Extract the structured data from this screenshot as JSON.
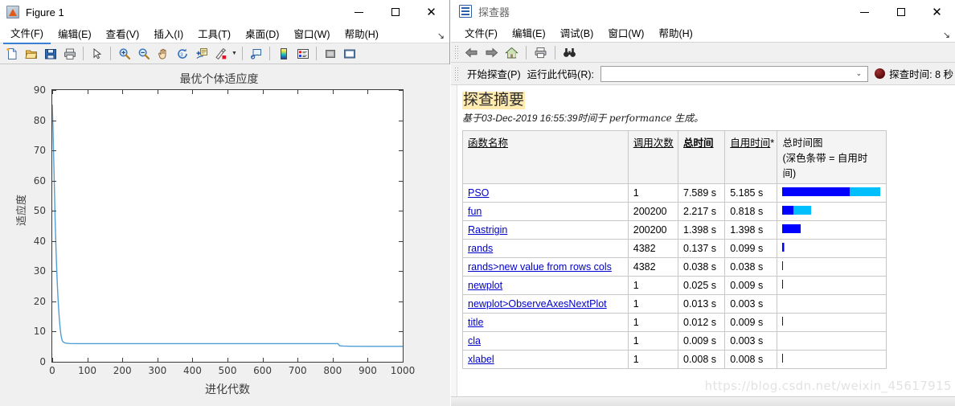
{
  "figure_window": {
    "title": "Figure 1",
    "icon": "matlab-figure-icon",
    "window_controls": [
      {
        "name": "minimize",
        "glyph": "—"
      },
      {
        "name": "maximize",
        "glyph": "□"
      },
      {
        "name": "close",
        "glyph": "✕"
      }
    ],
    "menus": [
      {
        "label": "文件(F)",
        "active": true
      },
      {
        "label": "编辑(E)",
        "active": false
      },
      {
        "label": "查看(V)",
        "active": false
      },
      {
        "label": "插入(I)",
        "active": false
      },
      {
        "label": "工具(T)",
        "active": false
      },
      {
        "label": "桌面(D)",
        "active": false
      },
      {
        "label": "窗口(W)",
        "active": false
      },
      {
        "label": "帮助(H)",
        "active": false
      }
    ],
    "menu_expand_glyph": "↘",
    "toolbar_icons": [
      "new-figure-icon",
      "open-file-icon",
      "save-figure-icon",
      "print-figure-icon",
      "separator",
      "pointer-icon",
      "separator",
      "zoom-in-icon",
      "zoom-out-icon",
      "pan-icon",
      "rotate-3d-icon",
      "data-cursor-icon",
      "brush-icon",
      "brush-dropdown-caret",
      "separator",
      "link-plot-icon",
      "separator",
      "colorbar-icon",
      "legend-icon",
      "separator",
      "hide-plot-tools-icon",
      "show-plot-tools-icon"
    ]
  },
  "chart_data": {
    "type": "line",
    "title": "最优个体适应度",
    "xlabel": "进化代数",
    "ylabel": "适应度",
    "xlim": [
      0,
      1000
    ],
    "ylim": [
      0,
      90
    ],
    "xticks": [
      0,
      100,
      200,
      300,
      400,
      500,
      600,
      700,
      800,
      900,
      1000
    ],
    "yticks": [
      0,
      10,
      20,
      30,
      40,
      50,
      60,
      70,
      80,
      90
    ],
    "grid": false,
    "legend": null,
    "line_color": "#4f9fd4",
    "series": [
      {
        "name": "最优个体适应度",
        "x": [
          0,
          2,
          4,
          6,
          8,
          10,
          12,
          14,
          16,
          18,
          20,
          22,
          24,
          26,
          28,
          30,
          35,
          40,
          50,
          70,
          100,
          150,
          200,
          300,
          400,
          500,
          600,
          700,
          800,
          815,
          818,
          820,
          830,
          850,
          900,
          950,
          1000
        ],
        "values": [
          85.2,
          78.0,
          68.0,
          58.0,
          48.0,
          40.0,
          33.0,
          27.0,
          22.0,
          18.0,
          14.5,
          11.8,
          9.6,
          8.2,
          7.2,
          6.7,
          6.3,
          6.15,
          6.05,
          6.0,
          6.0,
          6.0,
          6.0,
          6.0,
          6.0,
          6.0,
          6.0,
          6.0,
          6.0,
          6.0,
          5.6,
          5.3,
          5.2,
          5.15,
          5.1,
          5.1,
          5.1
        ]
      }
    ]
  },
  "profiler_window": {
    "title": "探查器",
    "icon": "profiler-document-icon",
    "window_controls": [
      {
        "name": "minimize",
        "glyph": "—"
      },
      {
        "name": "maximize",
        "glyph": "□"
      },
      {
        "name": "close",
        "glyph": "✕"
      }
    ],
    "menus": [
      {
        "label": "文件(F)"
      },
      {
        "label": "编辑(E)"
      },
      {
        "label": "调试(B)"
      },
      {
        "label": "窗口(W)"
      },
      {
        "label": "帮助(H)"
      }
    ],
    "menu_expand_glyph": "↘",
    "toolbar_icons": [
      "back-arrow-icon",
      "forward-arrow-icon",
      "home-icon",
      "print-icon",
      "find-binoculars-icon"
    ],
    "runbar": {
      "start_profiling_label": "开始探查(P)",
      "run_code_label": "运行此代码(R):",
      "code_input_value": "",
      "code_input_placeholder": "",
      "dropdown_glyph": "⌄",
      "profile_time_label": "探查时间: 8 秒"
    },
    "summary": {
      "heading": "探查摘要",
      "subtitle_prefix": "基于03-Dec-2019 16:55:39时间于 ",
      "subtitle_em": "performance",
      "subtitle_suffix": " 生成。"
    },
    "table": {
      "headers": {
        "function_name": "函数名称",
        "calls": "调用次数",
        "total_time": "总时间",
        "self_time": "自用时间",
        "self_time_sup": "*",
        "plot_line1": "总时间图",
        "plot_line2": "(深色条带 = 自用时间)"
      },
      "bar_colors": {
        "self": "#0000ff",
        "total": "#00bfff"
      },
      "rows": [
        {
          "function": "PSO",
          "calls": "1",
          "total_time": "7.589 s",
          "self_time": "5.185 s",
          "self_pct": 68.3,
          "total_pct": 100
        },
        {
          "function": "fun",
          "calls": "200200",
          "total_time": "2.217 s",
          "self_time": "0.818 s",
          "self_pct": 10.8,
          "total_pct": 29.2
        },
        {
          "function": "Rastrigin",
          "calls": "200200",
          "total_time": "1.398 s",
          "self_time": "1.398 s",
          "self_pct": 18.4,
          "total_pct": 18.4
        },
        {
          "function": "rands",
          "calls": "4382",
          "total_time": "0.137 s",
          "self_time": "0.099 s",
          "self_pct": 1.3,
          "total_pct": 1.8
        },
        {
          "function": "rands>new value from rows cols",
          "calls": "4382",
          "total_time": "0.038 s",
          "self_time": "0.038 s",
          "self_pct": 0.5,
          "total_pct": 0.5
        },
        {
          "function": "newplot",
          "calls": "1",
          "total_time": "0.025 s",
          "self_time": "0.009 s",
          "self_pct": 0.1,
          "total_pct": 0.3
        },
        {
          "function": "newplot>ObserveAxesNextPlot",
          "calls": "1",
          "total_time": "0.013 s",
          "self_time": "0.003 s",
          "self_pct": 0.0,
          "total_pct": 0.2
        },
        {
          "function": "title",
          "calls": "1",
          "total_time": "0.012 s",
          "self_time": "0.009 s",
          "self_pct": 0.1,
          "total_pct": 0.2
        },
        {
          "function": "cla",
          "calls": "1",
          "total_time": "0.009 s",
          "self_time": "0.003 s",
          "self_pct": 0.0,
          "total_pct": 0.1
        },
        {
          "function": "xlabel",
          "calls": "1",
          "total_time": "0.008 s",
          "self_time": "0.008 s",
          "self_pct": 0.1,
          "total_pct": 0.1
        }
      ]
    },
    "watermark": "https://blog.csdn.net/weixin_45617915"
  }
}
